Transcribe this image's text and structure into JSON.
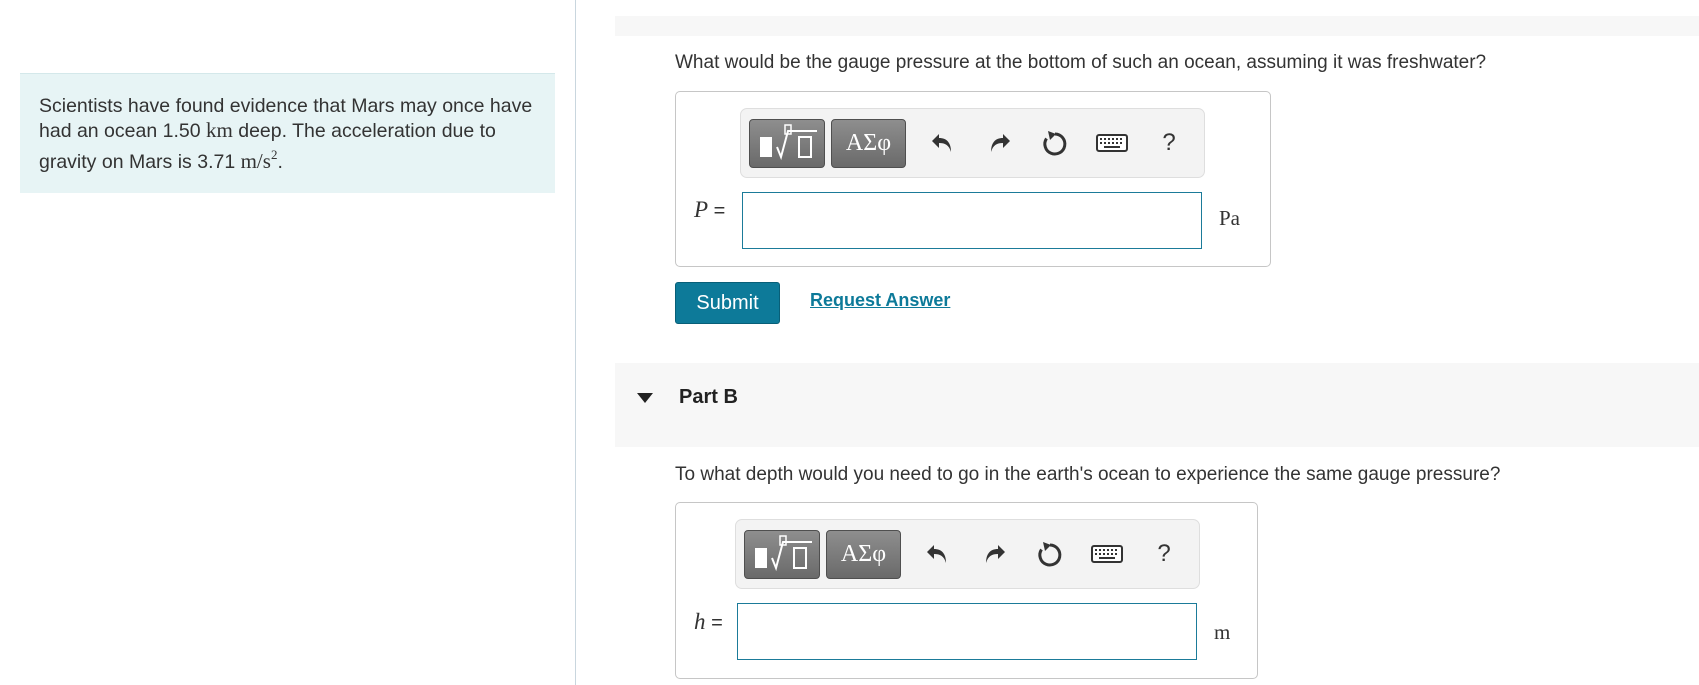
{
  "problem": {
    "line1": "Scientists have found evidence that Mars may once have",
    "line2_pre": "had an ocean ",
    "depth_value": "1.50",
    "depth_unit": "km",
    "line2_post": " deep. The acceleration due to",
    "line3_pre": "gravity on Mars is ",
    "gravity_value": "3.71",
    "gravity_unit": "m/s",
    "gravity_exp": "2",
    "line3_post": "."
  },
  "toolbar": {
    "templates_icon": "templates-sqrt-icon",
    "greek_label": "ΑΣφ",
    "undo_icon": "undo-icon",
    "redo_icon": "redo-icon",
    "reset_icon": "reset-icon",
    "keyboard_icon": "keyboard-icon",
    "help_label": "?"
  },
  "partA": {
    "question": "What would be the gauge pressure at the bottom of such an ocean, assuming it was freshwater?",
    "var": "P",
    "equals": "=",
    "value": "",
    "unit": "Pa",
    "submit_label": "Submit",
    "request_label": "Request Answer"
  },
  "partB": {
    "title": "Part B",
    "question": "To what depth would you need to go in the earth's ocean to experience the same gauge pressure?",
    "var": "h",
    "equals": "=",
    "value": "",
    "unit": "m"
  },
  "colors": {
    "accent": "#0d7a99",
    "problem_bg": "#e7f4f5",
    "panel_bg": "#f7f7f7"
  }
}
